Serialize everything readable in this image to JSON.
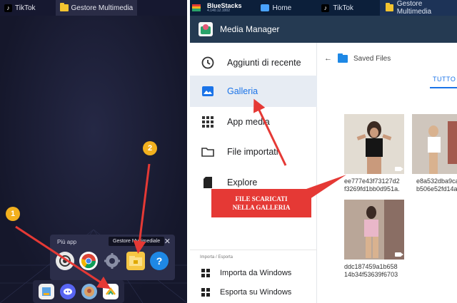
{
  "left_window": {
    "tabs": [
      {
        "label": "TikTok",
        "icon": "tiktok-icon"
      },
      {
        "label": "Gestore Multimedia",
        "icon": "folder-icon"
      }
    ],
    "popup": {
      "title": "Più app",
      "tooltip": "Gestore Multimediale",
      "close": "✕",
      "icons": [
        "camera-icon",
        "chrome-icon",
        "settings-icon",
        "media-manager-icon",
        "help-icon"
      ]
    },
    "dock_icons": [
      "download-app-icon",
      "discord-icon",
      "game-app-icon",
      "more-apps-icon"
    ],
    "badges": {
      "one": "1",
      "two": "2"
    }
  },
  "right_window": {
    "tabs": [
      {
        "label": "BlueStacks",
        "icon": "bluestacks-logo"
      },
      {
        "label": "Home",
        "icon": "home-icon"
      },
      {
        "label": "TikTok",
        "icon": "tiktok-icon"
      },
      {
        "label": "Gestore Multimedia",
        "icon": "folder-icon"
      }
    ],
    "bluestacks_version": "4.140.12.1002",
    "app_title": "Media Manager",
    "nav": [
      {
        "label": "Aggiunti di recente",
        "icon": "clock-icon"
      },
      {
        "label": "Galleria",
        "icon": "image-icon"
      },
      {
        "label": "App media",
        "icon": "apps-grid-icon"
      },
      {
        "label": "File importati",
        "icon": "folder-outline-icon"
      },
      {
        "label": "Explore",
        "icon": "sd-card-icon"
      }
    ],
    "nav_section": "Importa / Esporta",
    "nav_sub": [
      {
        "label": "Importa da Windows",
        "icon": "import-icon"
      },
      {
        "label": "Esporta su Windows",
        "icon": "export-icon"
      }
    ],
    "breadcrumb": {
      "back": "←",
      "folder": "Saved Files"
    },
    "tab_all": "TUTTO",
    "files": [
      {
        "line1": "ee777e43f73127d2",
        "line2": "f3269fd1bb0d951a."
      },
      {
        "line1": "e8a532dba9ca",
        "line2": "b506e52fd14a"
      },
      {
        "line1": "ddc187459a1b658",
        "line2": "14b34f53639f6703"
      }
    ]
  },
  "callout": {
    "line1": "FILE SCARICATI",
    "line2": "NELLA GALLERIA"
  },
  "colors": {
    "accent": "#1a73e8",
    "arrow": "#e53935",
    "badge": "#f2b01e",
    "appbar": "#253a52"
  }
}
